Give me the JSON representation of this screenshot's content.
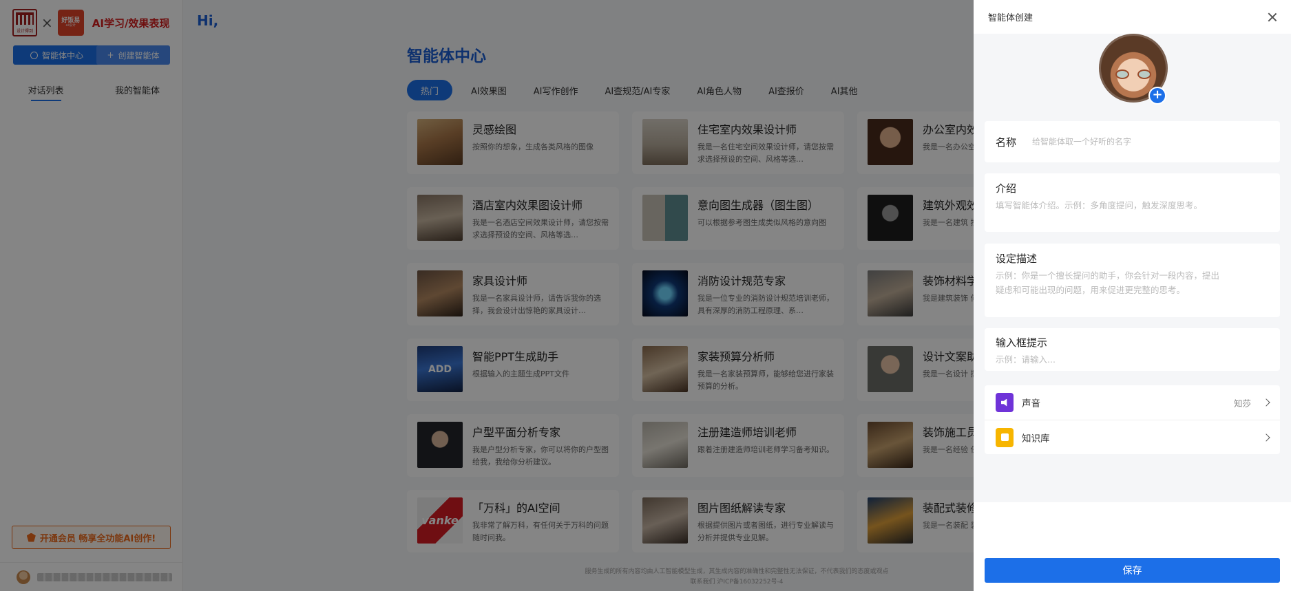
{
  "sidebar": {
    "brand_title": "AI学习/效果表现",
    "logo_a_caption": "设计得到",
    "logo_b_text": "好饭易",
    "logo_b_sub": "ai设计",
    "btn_agent_center": "智能体中心",
    "btn_create_agent": "创建智能体",
    "tab_conversations": "对话列表",
    "tab_my_agents": "我的智能体",
    "vip_banner": "开通会员 畅享全功能AI创作!"
  },
  "main": {
    "greeting": "Hi,",
    "title": "智能体中心",
    "categories": [
      "热门",
      "AI效果图",
      "AI写作创作",
      "AI查规范/AI专家",
      "AI角色人物",
      "AI查报价",
      "AI其他"
    ],
    "cards": [
      {
        "title": "灵感绘图",
        "desc": "按照你的想象，生成各类风格的图像"
      },
      {
        "title": "住宅室内效果设计师",
        "desc": "我是一名住宅空间效果设计师，请您按需求选择预设的空间、风格等选…"
      },
      {
        "title": "办公室内效",
        "desc": "我是一名办公空 按需求选择预设"
      },
      {
        "title": "酒店室内效果图设计师",
        "desc": "我是一名酒店空间效果设计师，请您按需求选择预设的空间、风格等选…"
      },
      {
        "title": "意向图生成器（图生图）",
        "desc": "可以根据参考图生成类似风格的意向图"
      },
      {
        "title": "建筑外观效",
        "desc": "我是一名建筑 按需求选择预设"
      },
      {
        "title": "家具设计师",
        "desc": "我是一名家具设计师，请告诉我你的选择，我会设计出惊艳的家具设计…"
      },
      {
        "title": "消防设计规范专家",
        "desc": "我是一位专业的消防设计规范培训老师，具有深厚的消防工程原理、系…"
      },
      {
        "title": "装饰材料学",
        "desc": "我是建筑装饰 何关于装饰材"
      },
      {
        "title": "智能PPT生成助手",
        "desc": "根据输入的主题生成PPT文件"
      },
      {
        "title": "家装预算分析师",
        "desc": "我是一名家装预算师，能够给您进行家装预算的分析。"
      },
      {
        "title": "设计文案助",
        "desc": "我是一名设计 撰写设计解说"
      },
      {
        "title": "户型平面分析专家",
        "desc": "我是户型分析专家，你可以将你的户型图给我，我给你分析建议。"
      },
      {
        "title": "注册建造师培训老师",
        "desc": "跟着注册建造师培训老师学习备考知识。"
      },
      {
        "title": "装饰施工员",
        "desc": "我是一名经验 任何问题请问"
      },
      {
        "title": "「万科」的AI空间",
        "desc": "我非常了解万科，有任何关于万科的问题随时问我。"
      },
      {
        "title": "图片图纸解读专家",
        "desc": "根据提供图片或者图纸，进行专业解读与分析并提供专业见解。"
      },
      {
        "title": "装配式装修",
        "desc": "我是一名装配 装配式政策及"
      }
    ],
    "thumb_text_vanke": "vanke",
    "thumb_text_ppt": "ADD",
    "footer_line1": "服务生成的所有内容均由人工智能模型生成，其生成内容的准确性和完整性无法保证，不代表我们的态度或观点",
    "footer_line2": "联系我们    沪ICP备16032252号-4"
  },
  "drawer": {
    "title": "智能体创建",
    "name_label": "名称",
    "name_placeholder": "给智能体取一个好听的名字",
    "intro_label": "介绍",
    "intro_placeholder": "填写智能体介绍。示例：多角度提问，触发深度思考。",
    "desc_label": "设定描述",
    "desc_placeholder": "示例：你是一个擅长提问的助手，你会针对一段内容，提出疑虑和可能出现的问题，用来促进更完整的思考。",
    "hint_label": "输入框提示",
    "hint_placeholder": "示例：请输入...",
    "voice_label": "声音",
    "voice_value": "知莎",
    "kb_label": "知识库",
    "save_label": "保存"
  },
  "colors": {
    "primary": "#1c6fe8",
    "brand_red": "#d41e1e",
    "vip_orange": "#ee6a1c",
    "voice_purple": "#6f33d8",
    "kb_yellow": "#f7b500"
  }
}
